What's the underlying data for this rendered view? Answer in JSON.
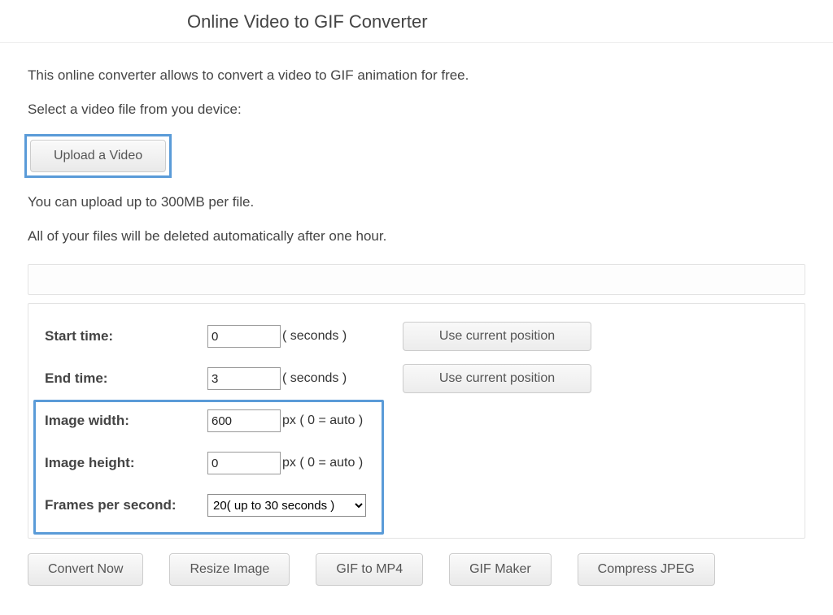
{
  "title": "Online Video to GIF Converter",
  "intro": "This online converter allows to convert a video to GIF animation for free.",
  "selectLabel": "Select a video file from you device:",
  "uploadButton": "Upload a Video",
  "uploadNote": "You can upload up to 300MB per file.",
  "deleteNote": "All of your files will be deleted automatically after one hour.",
  "settings": {
    "startLabel": "Start time:",
    "startValue": "0",
    "startUnit": "( seconds )",
    "endLabel": "End time:",
    "endValue": "3",
    "endUnit": "( seconds )",
    "useCurrent": "Use current position",
    "widthLabel": "Image width:",
    "widthValue": "600",
    "pxUnit": "px ( 0 = auto )",
    "heightLabel": "Image height:",
    "heightValue": "0",
    "fpsLabel": "Frames per second:",
    "fpsOption": "20( up to 30 seconds )"
  },
  "actions": {
    "convert": "Convert Now",
    "resize": "Resize Image",
    "gif2mp4": "GIF to MP4",
    "gifmaker": "GIF Maker",
    "compressJpeg": "Compress JPEG"
  }
}
